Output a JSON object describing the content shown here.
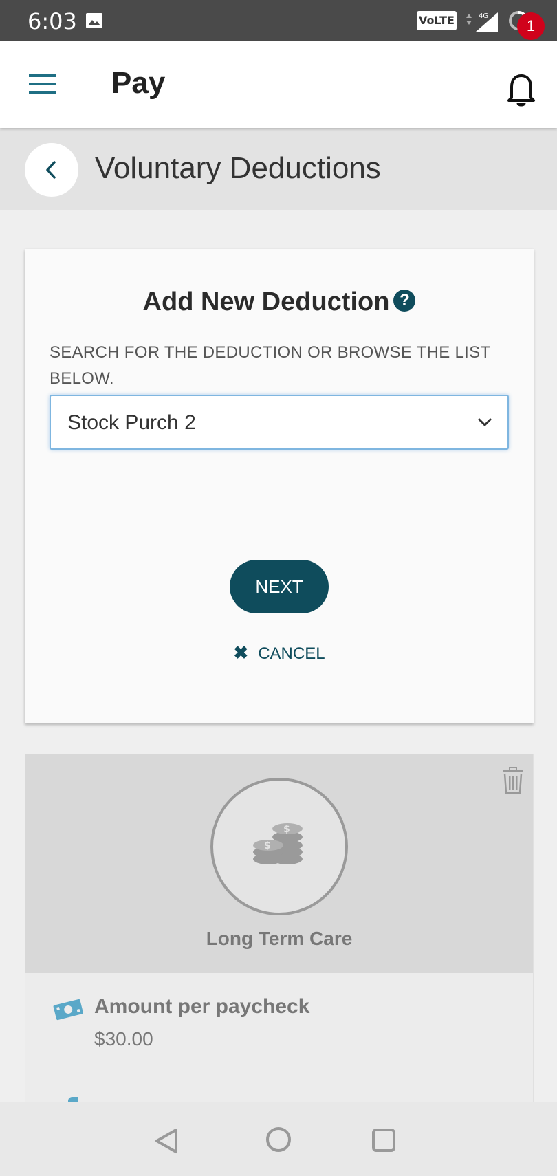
{
  "status_bar": {
    "time": "6:03",
    "network_badge": "VoLTE",
    "network_type": "4G",
    "icons": [
      "image-icon",
      "signal-icon",
      "loading-icon"
    ]
  },
  "app_bar": {
    "title": "Pay",
    "notification_count": "1",
    "icons": [
      "menu-icon",
      "bell-icon"
    ]
  },
  "page_header": {
    "title": "Voluntary Deductions",
    "icon": "chevron-left-icon"
  },
  "add_card": {
    "title": "Add New Deduction",
    "help_glyph": "?",
    "instruction": "SEARCH FOR THE DEDUCTION OR BROWSE THE LIST BELOW.",
    "select_value": "Stock Purch 2",
    "next_label": "NEXT",
    "cancel_label": "CANCEL",
    "cancel_glyph": "✖"
  },
  "deduction": {
    "name": "Long Term Care",
    "amount_label": "Amount per paycheck",
    "amount_value": "$30.00",
    "icons": [
      "coins-icon",
      "trash-icon",
      "money-icon"
    ]
  },
  "colors": {
    "accent": "#0f4c5c",
    "badge": "#d0021b",
    "status_bar": "#4a4a4a",
    "money_icon": "#5aa8c8"
  }
}
